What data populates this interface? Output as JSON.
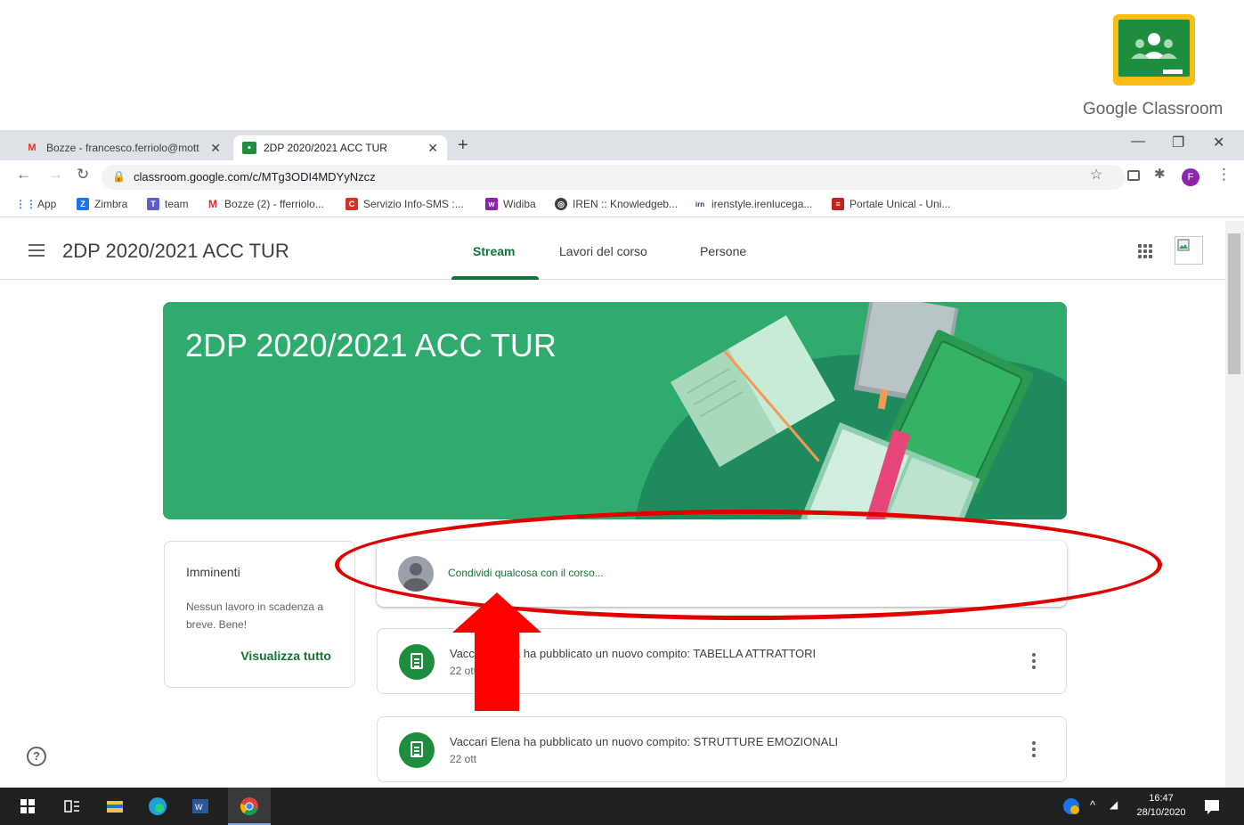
{
  "logo": {
    "text": "Google Classroom"
  },
  "browser": {
    "tabs": [
      {
        "label": "Bozze - francesco.ferriolo@mott",
        "icon": "gmail-icon",
        "active": false
      },
      {
        "label": "2DP 2020/2021 ACC TUR",
        "icon": "classroom-icon",
        "active": true
      }
    ],
    "new_tab": "+",
    "url": "classroom.google.com/c/MTg3ODI4MDYyNzcz",
    "profile_initial": "F",
    "bookmarks": [
      {
        "label": "App",
        "icon": "apps-grid-icon"
      },
      {
        "label": "Zimbra",
        "icon": "zimbra-icon"
      },
      {
        "label": "team",
        "icon": "teams-icon"
      },
      {
        "label": "Bozze (2) - fferriolo...",
        "icon": "gmail-icon"
      },
      {
        "label": "Servizio Info-SMS :...",
        "icon": "sms-icon"
      },
      {
        "label": "Widiba",
        "icon": "widiba-icon"
      },
      {
        "label": "IREN :: Knowledgeb...",
        "icon": "globe-icon"
      },
      {
        "label": "irenstyle.irenlucega...",
        "icon": "iren-icon"
      },
      {
        "label": "Portale Unical - Uni...",
        "icon": "unical-icon"
      }
    ]
  },
  "classroom": {
    "header_title": "2DP 2020/2021 ACC TUR",
    "tabs": [
      "Stream",
      "Lavori del corso",
      "Persone"
    ],
    "active_tab": "Stream",
    "banner_title": "2DP 2020/2021 ACC TUR",
    "upcoming": {
      "title": "Imminenti",
      "message": "Nessun lavoro in scadenza a breve. Bene!",
      "link": "Visualizza tutto"
    },
    "share_placeholder": "Condividi qualcosa con il corso...",
    "posts": [
      {
        "title": "Vaccari Elena ha pubblicato un nuovo compito: TABELLA ATTRATTORI",
        "date": "22 ott"
      },
      {
        "title": "Vaccari Elena ha pubblicato un nuovo compito: STRUTTURE EMOZIONALI",
        "date": "22 ott"
      }
    ]
  },
  "taskbar": {
    "time": "16:47",
    "date": "28/10/2020"
  },
  "colors": {
    "accent_green": "#137333",
    "banner_green": "#2eab6d",
    "annotation_red": "#e00000"
  }
}
